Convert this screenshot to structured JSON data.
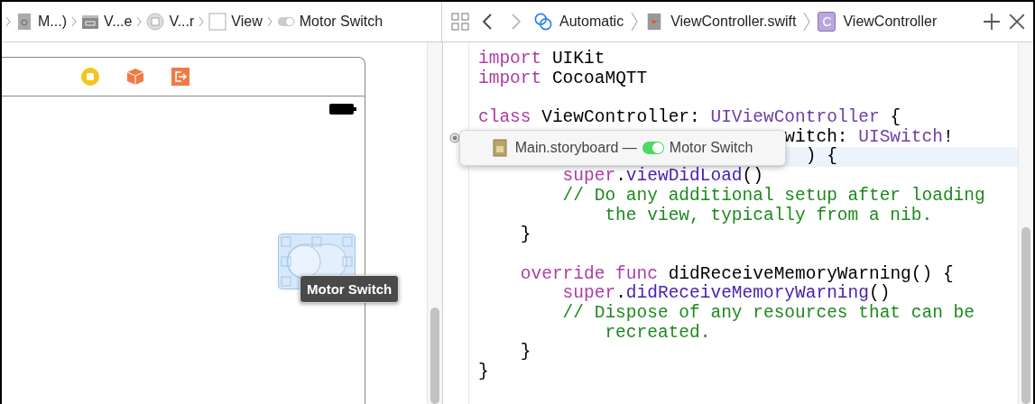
{
  "jump_bar": {
    "items": [
      {
        "kind": "storyboard",
        "label": "M...)"
      },
      {
        "kind": "scene",
        "label": "V...e"
      },
      {
        "kind": "controller",
        "label": "V...r"
      },
      {
        "kind": "view",
        "label": "View"
      },
      {
        "kind": "switch",
        "label": "Motor Switch"
      }
    ]
  },
  "editor_bar": {
    "back": {
      "disabled": false
    },
    "forward": {
      "disabled": true
    },
    "path": [
      {
        "kind": "related",
        "label": "Automatic"
      },
      {
        "kind": "swift",
        "label": "ViewController.swift"
      },
      {
        "kind": "class",
        "badge": "C",
        "label": "ViewController"
      }
    ]
  },
  "canvas": {
    "selected_control_tooltip": "Motor Switch"
  },
  "code": {
    "lines": [
      {
        "kind": "code",
        "current": false,
        "tokens": [
          {
            "kind": "keyword",
            "text": "import"
          },
          {
            "kind": "plain",
            "text": " UIKit"
          }
        ]
      },
      {
        "kind": "code",
        "current": false,
        "tokens": [
          {
            "kind": "keyword",
            "text": "import"
          },
          {
            "kind": "plain",
            "text": " CocoaMQTT"
          }
        ]
      },
      {
        "kind": "code",
        "current": false,
        "blank_line_before": true,
        "tokens": [
          {
            "kind": "keyword",
            "text": "class"
          },
          {
            "kind": "plain",
            "text": " ViewController: "
          },
          {
            "kind": "type",
            "text": "UIViewController"
          },
          {
            "kind": "plain",
            "text": " {"
          }
        ]
      },
      {
        "kind": "outlet",
        "current": false,
        "connected": true,
        "tokens": [
          {
            "kind": "plain",
            "text": "witch: "
          },
          {
            "kind": "type",
            "text": "UISwitch"
          },
          {
            "kind": "plain",
            "text": "!"
          }
        ]
      },
      {
        "kind": "signature",
        "current": true,
        "tokens": [
          {
            "kind": "plain",
            "text": ") {"
          }
        ]
      },
      {
        "kind": "code",
        "current": false,
        "tokens": [
          {
            "kind": "keyword",
            "text": "        super"
          },
          {
            "kind": "plain",
            "text": "."
          },
          {
            "kind": "method",
            "text": "viewDidLoad"
          },
          {
            "kind": "plain",
            "text": "()"
          }
        ]
      },
      {
        "kind": "code",
        "current": false,
        "tokens": [
          {
            "kind": "comment",
            "text": "        // Do any additional setup after loading"
          }
        ]
      },
      {
        "kind": "code",
        "current": false,
        "tokens": [
          {
            "kind": "comment",
            "text": "            the view, typically from a nib."
          }
        ]
      },
      {
        "kind": "code",
        "current": false,
        "tokens": [
          {
            "kind": "plain",
            "text": "    }"
          }
        ]
      },
      {
        "kind": "code",
        "current": false,
        "blank_line_before": true,
        "tokens": [
          {
            "kind": "keyword",
            "text": "    override func"
          },
          {
            "kind": "plain",
            "text": " didReceiveMemoryWarning() {"
          }
        ]
      },
      {
        "kind": "code",
        "current": false,
        "tokens": [
          {
            "kind": "keyword",
            "text": "        super"
          },
          {
            "kind": "plain",
            "text": "."
          },
          {
            "kind": "method",
            "text": "didReceiveMemoryWarning"
          },
          {
            "kind": "plain",
            "text": "()"
          }
        ]
      },
      {
        "kind": "code",
        "current": false,
        "tokens": [
          {
            "kind": "comment",
            "text": "        // Dispose of any resources that can be"
          }
        ]
      },
      {
        "kind": "code",
        "current": false,
        "tokens": [
          {
            "kind": "comment",
            "text": "            recreated."
          }
        ]
      },
      {
        "kind": "code",
        "current": false,
        "tokens": [
          {
            "kind": "plain",
            "text": "    }"
          }
        ]
      },
      {
        "kind": "code",
        "current": false,
        "tokens": [
          {
            "kind": "plain",
            "text": "}"
          }
        ]
      }
    ]
  },
  "connection_popup": {
    "file": "Main.storyboard —",
    "outlet": "Motor Switch",
    "switch_on": true
  }
}
